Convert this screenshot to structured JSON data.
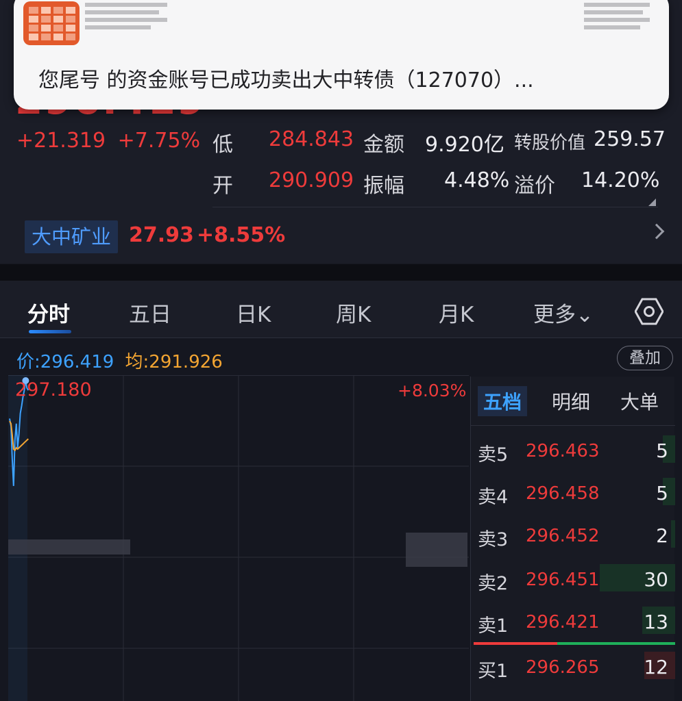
{
  "quote": {
    "price_partial": "296.419",
    "change_abs": "+21.319",
    "change_pct": "+7.75%"
  },
  "stats": {
    "low_label": "低",
    "low_value": "284.843",
    "amount_label": "金额",
    "amount_value": "9.920亿",
    "conv_label": "转股价值",
    "conv_value": "259.57",
    "open_label": "开",
    "open_value": "290.909",
    "amplitude_label": "振幅",
    "amplitude_value": "4.48%",
    "premium_label": "溢价",
    "premium_value": "14.20%"
  },
  "underlying": {
    "name": "大中矿业",
    "price": "27.93",
    "pct": "+8.55%"
  },
  "notification": {
    "text": "您尾号                       的资金账号已成功卖出大中转债（127070）..."
  },
  "tabs": [
    {
      "label": "分时",
      "active": true
    },
    {
      "label": "五日"
    },
    {
      "label": "日K"
    },
    {
      "label": "周K"
    },
    {
      "label": "月K"
    },
    {
      "label": "更多⌄"
    }
  ],
  "chart_header": {
    "price_label": "价:296.419",
    "avg_label": "均:291.926",
    "overlay_button": "叠加"
  },
  "chart_data": {
    "type": "line",
    "title": "",
    "high_label": "297.180",
    "high_pct_label": "+8.03%",
    "series": [
      {
        "values": [
          294.2,
          293.6,
          291.0,
          288.9,
          292.5,
          293.8,
          291.9,
          293.0,
          294.6,
          295.2,
          295.9,
          296.4,
          297.18,
          296.6,
          296.419
        ],
        "color": "#3da2ff"
      },
      {
        "values": [
          294.0,
          293.8,
          292.9,
          291.8,
          291.7,
          291.9,
          291.8,
          291.9,
          292.0,
          292.1,
          292.2,
          292.3,
          292.4,
          292.5,
          292.6
        ],
        "color": "#f3a532"
      }
    ],
    "ylim": [
      272.0,
      297.18
    ]
  },
  "orderbook": {
    "tabs": [
      "五档",
      "明细",
      "大单"
    ],
    "rows": [
      {
        "side": "卖5",
        "price": "296.463",
        "vol": "5",
        "bar": 0.06
      },
      {
        "side": "卖4",
        "price": "296.458",
        "vol": "5",
        "bar": 0.06
      },
      {
        "side": "卖3",
        "price": "296.452",
        "vol": "2",
        "bar": 0.02
      },
      {
        "side": "卖2",
        "price": "296.451",
        "vol": "30",
        "bar": 0.37
      },
      {
        "side": "卖1",
        "price": "296.421",
        "vol": "13",
        "bar": 0.16
      },
      {
        "side": "买1",
        "price": "296.265",
        "vol": "12",
        "bar": 0.15
      }
    ]
  },
  "colors": {
    "up": "#ee3b3b",
    "down": "#1fb05a",
    "accent": "#3da2ff",
    "avg": "#f3a532"
  }
}
